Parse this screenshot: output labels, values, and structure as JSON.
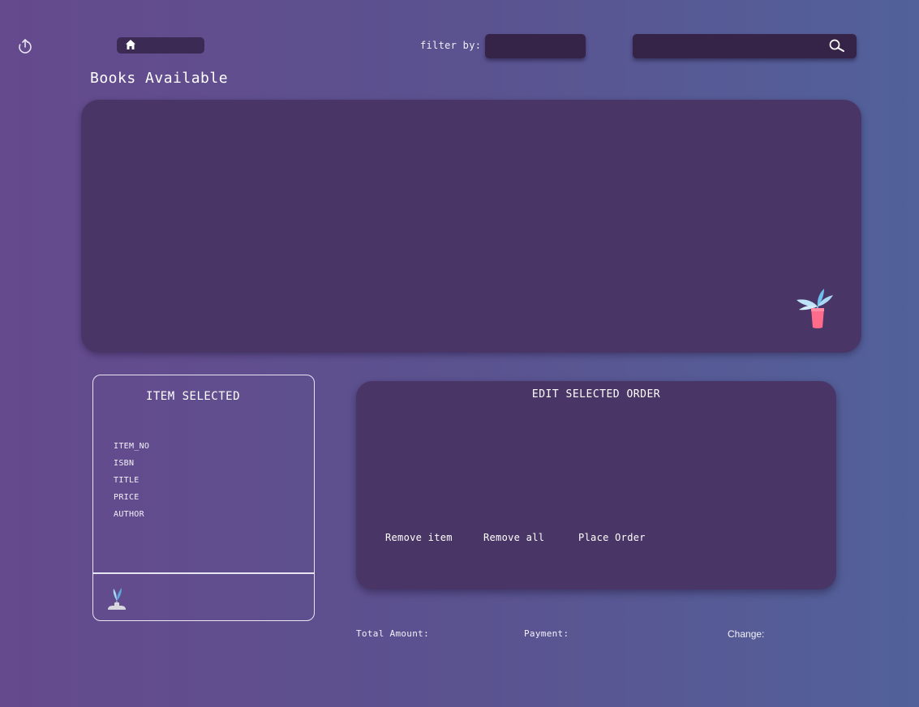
{
  "header": {
    "logout_icon": "power-icon",
    "home_icon": "home-icon",
    "filter_label": "filter by:",
    "filter_value": "",
    "search_value": "",
    "search_icon": "search-icon"
  },
  "books": {
    "title": "Books Available",
    "decoration_icon": "potted-plant-icon"
  },
  "item_selected": {
    "title": "ITEM SELECTED",
    "fields": [
      "ITEM_NO",
      "ISBN",
      "TITLE",
      "PRICE",
      "AUTHOR"
    ],
    "decoration_icon": "small-plant-icon"
  },
  "order": {
    "title": "EDIT SELECTED ORDER",
    "remove_item": "Remove item",
    "remove_all": "Remove all",
    "place_order": "Place Order"
  },
  "totals": {
    "total_label": "Total Amount:",
    "payment_label": "Payment:",
    "change_label": "Change:"
  },
  "colors": {
    "background_left": "#654a8d",
    "background_right": "#52619a",
    "panel": "#4a3666",
    "input": "#352447",
    "plant_pot": "#ff6b8a",
    "plant_leaf": "#a9d8f5"
  }
}
